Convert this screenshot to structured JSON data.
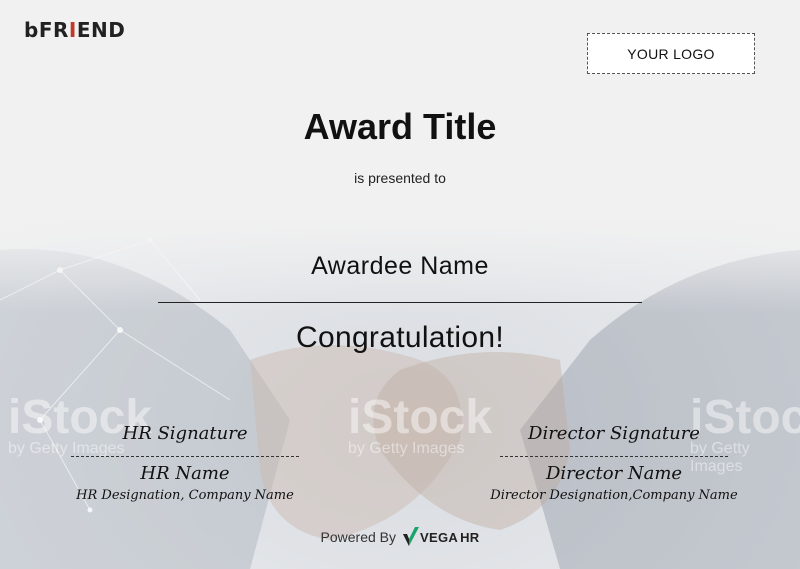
{
  "brand": {
    "prefix": "b",
    "name_a": "FR",
    "name_i": "I",
    "name_b": "END"
  },
  "logo_box": {
    "label": "YOUR LOGO"
  },
  "certificate": {
    "title": "Award Title",
    "presented_text": "is presented to",
    "awardee": "Awardee Name",
    "congrats": "Congratulation!"
  },
  "signatures": {
    "hr": {
      "signature": "HR Signature",
      "name": "HR Name",
      "designation": "HR Designation, Company Name"
    },
    "director": {
      "signature": "Director Signature",
      "name": "Director Name",
      "designation": "Director Designation,Company Name"
    }
  },
  "footer": {
    "powered_by": "Powered By",
    "vendor_a": "VEGA",
    "vendor_b": "HR"
  },
  "watermark": {
    "text": "iStock",
    "subtext": "by Getty Images"
  },
  "colors": {
    "accent_green": "#1aa36b",
    "accent_red": "#c0392b"
  }
}
